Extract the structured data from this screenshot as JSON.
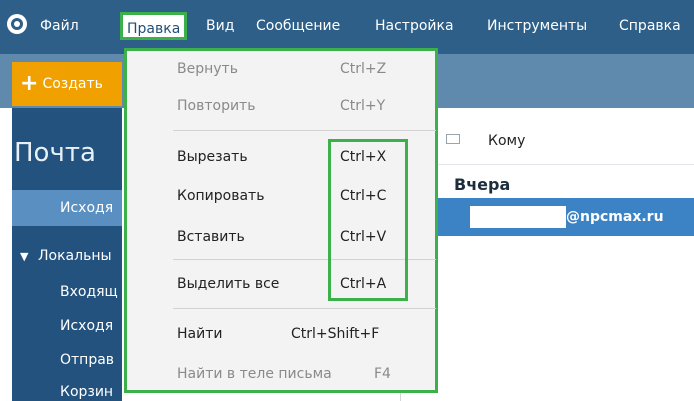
{
  "menubar": {
    "items": [
      "Файл",
      "Правка",
      "Вид",
      "Сообщение",
      "Настройка",
      "Инструменты",
      "Справка"
    ]
  },
  "toolbar": {
    "create_label": "Создать"
  },
  "sidebar": {
    "title": "Почта",
    "items": [
      "Исходя",
      "Локальны",
      "Входящ",
      "Исходя",
      "Отправ",
      "Корзин"
    ]
  },
  "list": {
    "column_to": "Кому",
    "date_group": "Вчера",
    "row_domain": "@npcmax.ru"
  },
  "dropdown": {
    "items": [
      {
        "label": "Вернуть",
        "shortcut": "Ctrl+Z",
        "enabled": false
      },
      {
        "label": "Повторить",
        "shortcut": "Ctrl+Y",
        "enabled": false
      },
      {
        "label": "Вырезать",
        "shortcut": "Ctrl+X",
        "enabled": true
      },
      {
        "label": "Копировать",
        "shortcut": "Ctrl+C",
        "enabled": true
      },
      {
        "label": "Вставить",
        "shortcut": "Ctrl+V",
        "enabled": true
      },
      {
        "label": "Выделить все",
        "shortcut": "Ctrl+A",
        "enabled": true
      },
      {
        "label": "Найти",
        "shortcut": "Ctrl+Shift+F",
        "enabled": true
      },
      {
        "label": "Найти в теле письма",
        "shortcut": "F4",
        "enabled": false
      }
    ]
  },
  "colors": {
    "menubar": "#2d5f88",
    "toolbar": "#5f89ad",
    "accent_orange": "#f0a100",
    "highlight_green": "#3cb04a"
  }
}
